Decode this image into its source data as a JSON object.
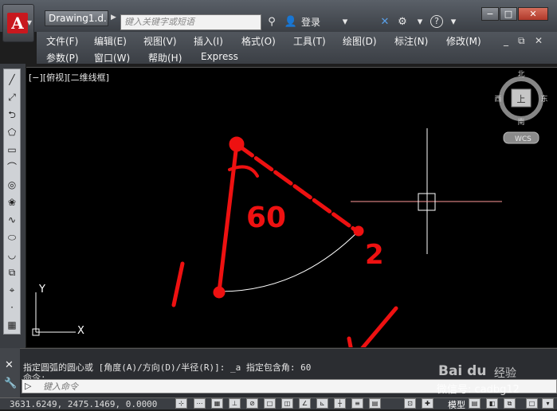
{
  "title_bar": {
    "doc_tab": "Drawing1.d...",
    "search_placeholder": "键入关键字或短语",
    "login_label": "登录"
  },
  "menu": {
    "row1": [
      "文件(F)",
      "编辑(E)",
      "视图(V)",
      "插入(I)",
      "格式(O)",
      "工具(T)",
      "绘图(D)",
      "标注(N)",
      "修改(M)"
    ],
    "row2": [
      "参数(P)",
      "窗口(W)",
      "帮助(H)",
      "Express"
    ]
  },
  "viewport": {
    "label": "[−][俯视][二维线框]",
    "viewcube": {
      "north": "北",
      "south": "南",
      "east": "东",
      "west": "西",
      "top": "上",
      "wcs": "WCS"
    },
    "annotations": {
      "angle": "60",
      "point1": "1",
      "point2": "2"
    },
    "ucs": {
      "y_label": "Y",
      "x_label": "X"
    }
  },
  "command": {
    "history_line": "指定圆弧的圆心或 [角度(A)/方向(D)/半径(R)]: _a 指定包含角: 60",
    "second_line": "命令:",
    "input_placeholder": "键入命令",
    "prompt_symbol": "▷"
  },
  "status": {
    "coordinates": "3631.6249, 2475.1469, 0.0000",
    "model_label": "模型"
  },
  "watermark": {
    "brand": "Bai du",
    "brand_suffix": "经验",
    "wechat": "微信号: cadbg12"
  },
  "colors": {
    "annotation_red": "#ee1111",
    "crosshair": "#ffffff",
    "arc": "#ffffff"
  }
}
